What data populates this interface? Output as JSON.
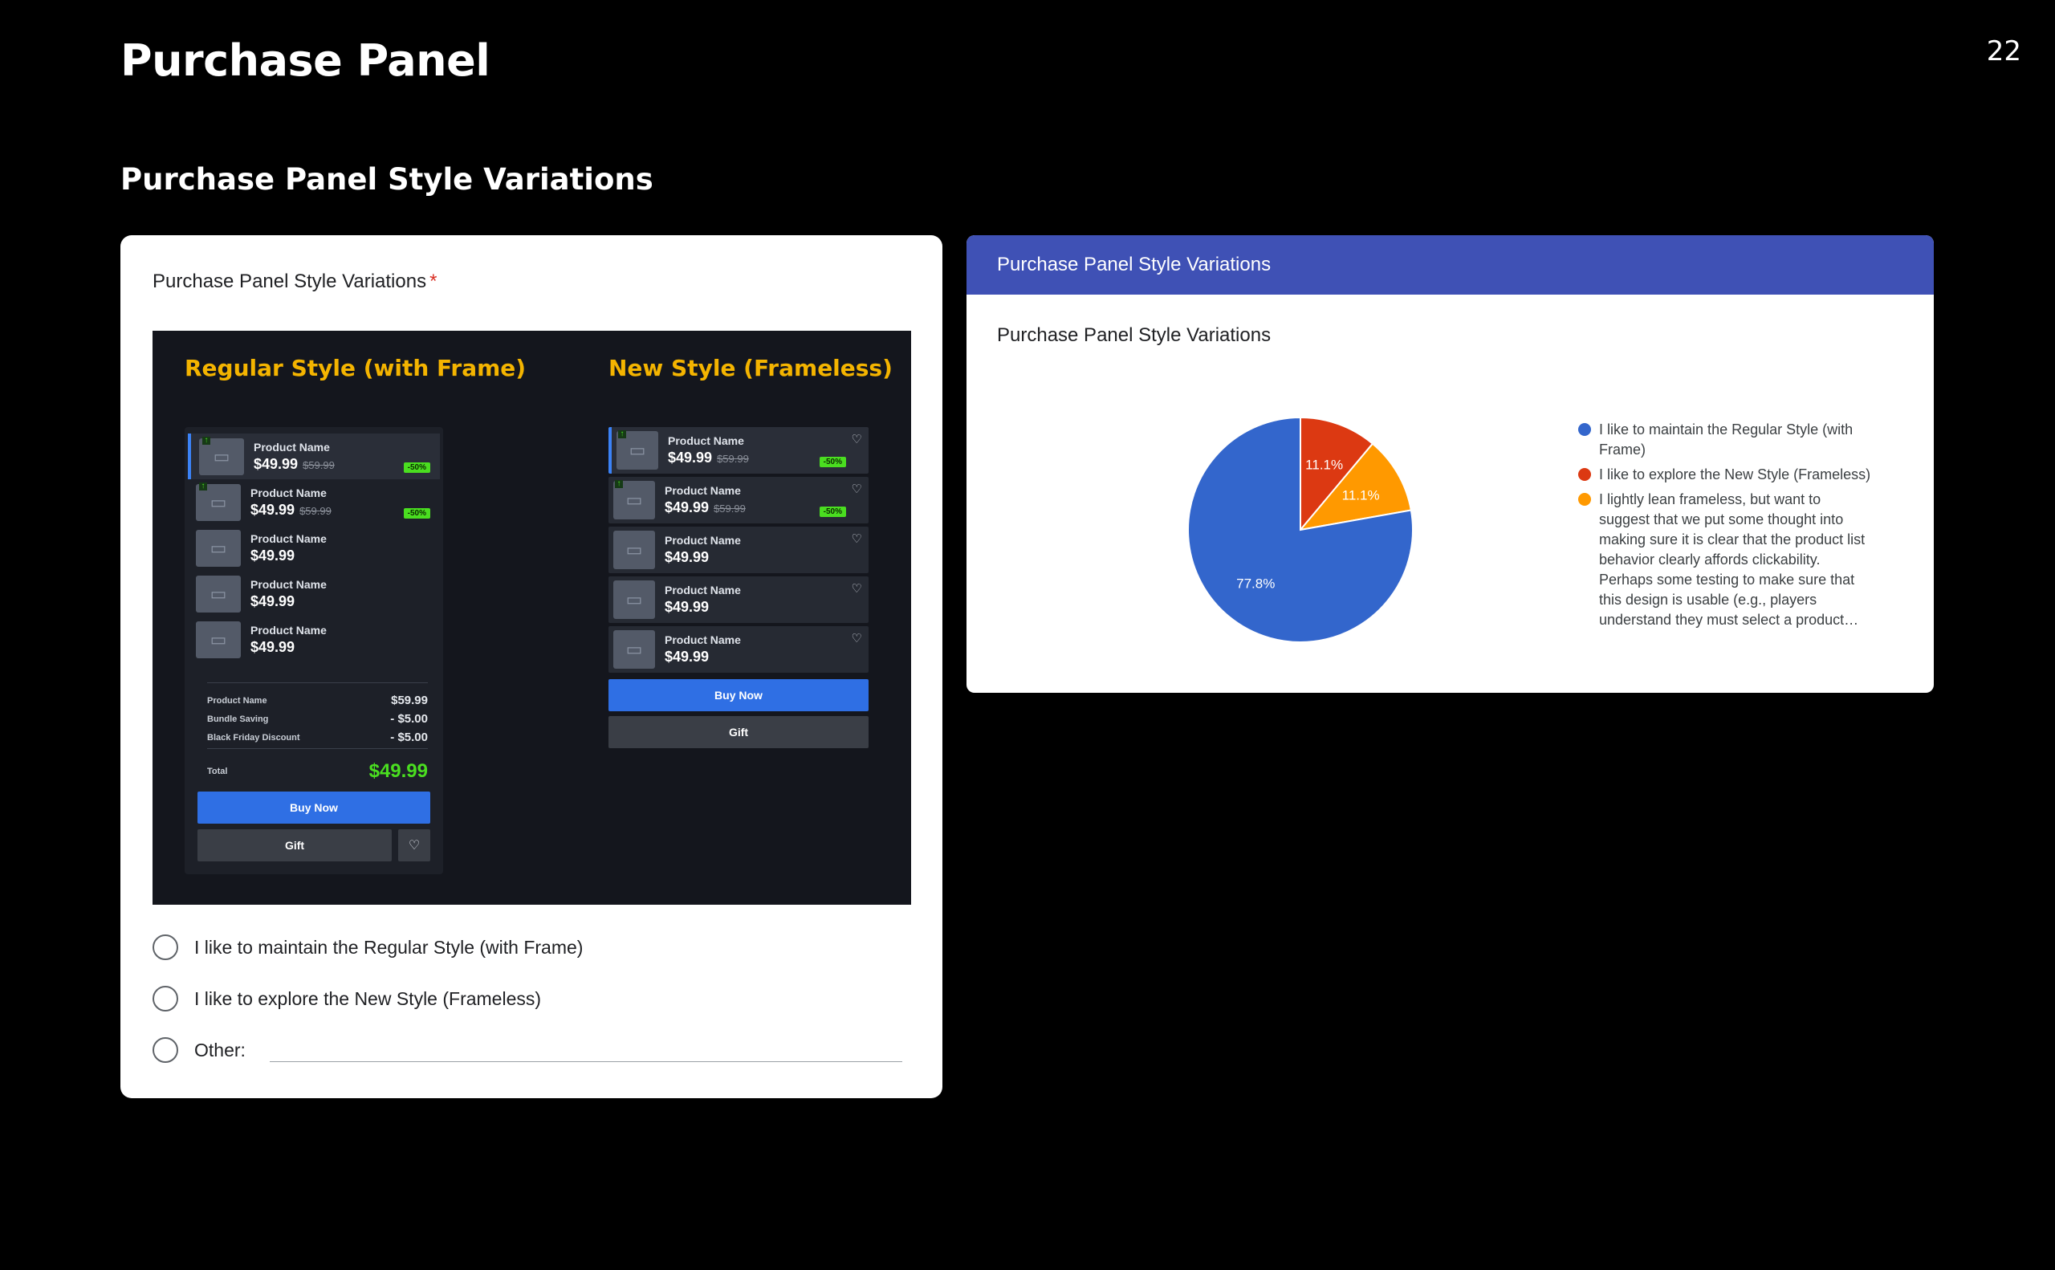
{
  "slide": {
    "title": "Purchase Panel",
    "page_number": "22",
    "section_title": "Purchase Panel Style Variations"
  },
  "form": {
    "question": "Purchase Panel Style Variations",
    "required_mark": "*",
    "preview": {
      "regular_heading": "Regular Style (with Frame)",
      "new_heading": "New Style (Frameless)",
      "regular_products": [
        {
          "name": "Product Name",
          "price": "$49.99",
          "old_price": "$59.99",
          "badge": "-50%",
          "arrow": "↑"
        },
        {
          "name": "Product Name",
          "price": "$49.99",
          "old_price": "$59.99",
          "badge": "-50%",
          "arrow": "↑"
        },
        {
          "name": "Product Name",
          "price": "$49.99"
        },
        {
          "name": "Product Name",
          "price": "$49.99"
        },
        {
          "name": "Product Name",
          "price": "$49.99"
        }
      ],
      "summary": [
        {
          "label": "Product Name",
          "value": "$59.99"
        },
        {
          "label": "Bundle Saving",
          "value": "- $5.00"
        },
        {
          "label": "Black Friday Discount",
          "value": "- $5.00"
        }
      ],
      "total_label": "Total",
      "total_value": "$49.99",
      "buy_label": "Buy Now",
      "gift_label": "Gift",
      "heart_icon": "♡",
      "new_products": [
        {
          "name": "Product Name",
          "price": "$49.99",
          "old_price": "$59.99",
          "badge": "-50%",
          "arrow": "↑"
        },
        {
          "name": "Product Name",
          "price": "$49.99",
          "old_price": "$59.99",
          "badge": "-50%",
          "arrow": "↑"
        },
        {
          "name": "Product Name",
          "price": "$49.99"
        },
        {
          "name": "Product Name",
          "price": "$49.99"
        },
        {
          "name": "Product Name",
          "price": "$49.99"
        }
      ]
    },
    "options": [
      "I like to maintain the Regular Style (with Frame)",
      "I like to explore the New Style (Frameless)",
      "Other:"
    ]
  },
  "results": {
    "header": "Purchase Panel Style Variations",
    "question": "Purchase Panel Style Variations",
    "chart_data": {
      "type": "pie",
      "slices": [
        {
          "label": "I like to maintain the Regular Style (with Frame)",
          "value": 77.8,
          "display": "77.8%",
          "color": "#3366cc"
        },
        {
          "label": "I like to explore the New Style (Frameless)",
          "value": 11.1,
          "display": "11.1%",
          "color": "#dc3912"
        },
        {
          "label": "I lightly lean frameless, but want to suggest that we put some thought into making sure it is clear that the product list behavior clearly affords clickability. Perhaps some testing to make sure that this design is usable (e.g., players understand they must select a product…",
          "value": 11.1,
          "display": "11.1%",
          "color": "#ff9900"
        }
      ],
      "legend_position": "right"
    }
  }
}
